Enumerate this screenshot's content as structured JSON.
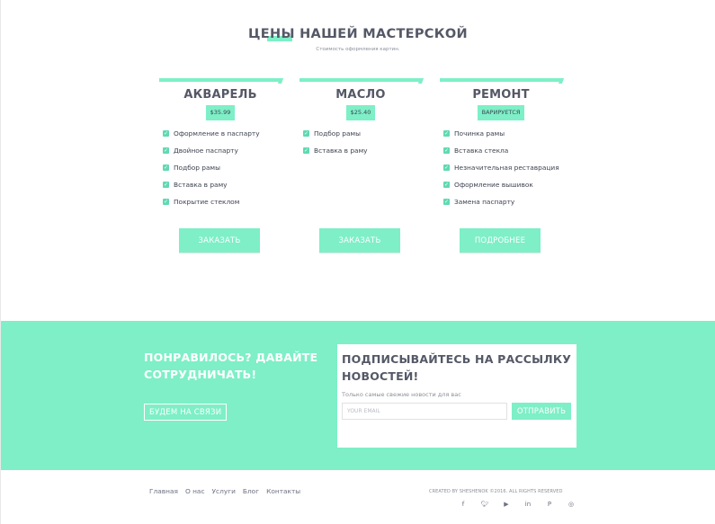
{
  "section": {
    "title": "ЦЕНЫ НАШЕЙ МАСТЕРСКОЙ",
    "subtitle": "Стоимость оформления картин."
  },
  "cards": [
    {
      "name": "АКВАРЕЛЬ",
      "price": "$35.99",
      "features": [
        "Оформление в паспарту",
        "Двойное паспарту",
        "Подбор рамы",
        "Вставка в раму",
        "Покрытие стеклом"
      ],
      "button": "ЗАКАЗАТЬ"
    },
    {
      "name": "МАСЛО",
      "price": "$25.40",
      "features": [
        "Подбор рамы",
        "Вставка в раму"
      ],
      "button": "ЗАКАЗАТЬ"
    },
    {
      "name": "РЕМОНТ",
      "price": "ВАРИРУЕТСЯ",
      "features": [
        "Починка рамы",
        "Вставка стекла",
        "Незначительная реставрация",
        "Оформление вышивок",
        "Замена паспарту"
      ],
      "button": "ПОДРОБНЕЕ"
    }
  ],
  "cta": {
    "title": "ПОНРАВИЛОСЬ? ДАВАЙТЕ СОТРУДНИЧАТЬ!",
    "button": "БУДЕМ НА СВЯЗИ"
  },
  "subscribe": {
    "title": "ПОДПИСЫВАЙТЕСЬ НА РАССЫЛКУ НОВОСТЕЙ!",
    "text": "Только самые свежие новости для вас",
    "email_placeholder": "YOUR EMAIL",
    "email_value": "",
    "button": "ОТПРАВИТЬ"
  },
  "footer": {
    "nav": [
      "Главная",
      "О нас",
      "Услуги",
      "Блог",
      "Контакты"
    ],
    "copyright": "CREATED BY SHESHENOK ©2016. ALL RIGHTS RESERVED",
    "social_icons": [
      "facebook-icon",
      "twitter-icon",
      "youtube-icon",
      "linkedin-icon",
      "pinterest-icon",
      "instagram-icon"
    ]
  },
  "colors": {
    "accent": "#7eefc7",
    "check": "#61d9b2",
    "heading": "#555866"
  }
}
